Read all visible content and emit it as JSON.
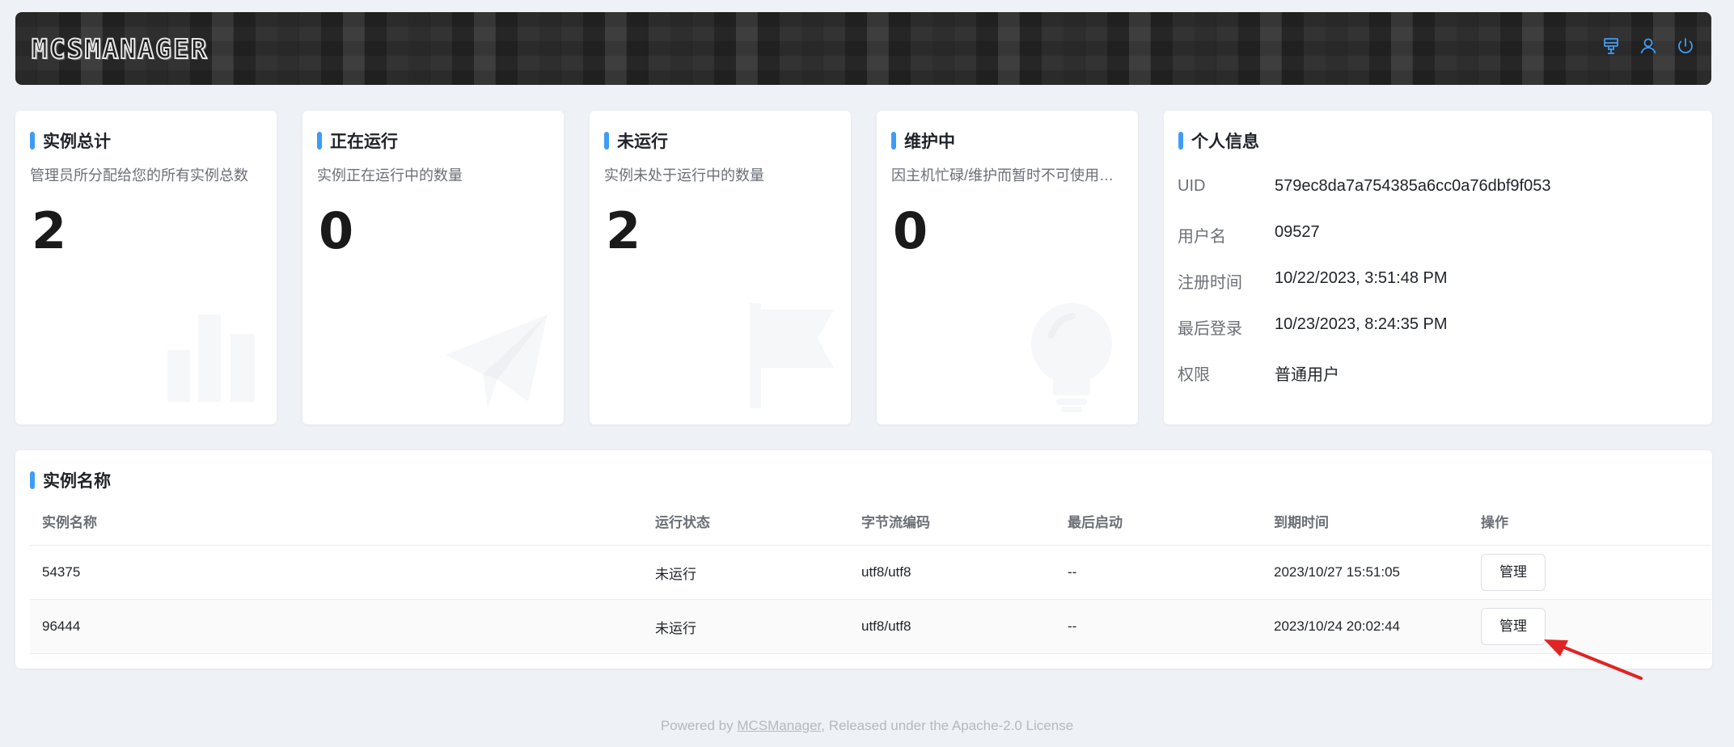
{
  "header": {
    "logo_text": "MCSMANAGER",
    "icons": [
      "plug-icon",
      "user-icon",
      "power-icon"
    ],
    "accent": "#3f9cf5"
  },
  "stats": [
    {
      "title": "实例总计",
      "desc": "管理员所分配给您的所有实例总数",
      "value": "2",
      "icon": "bar-chart-icon"
    },
    {
      "title": "正在运行",
      "desc": "实例正在运行中的数量",
      "value": "0",
      "icon": "paper-plane-icon"
    },
    {
      "title": "未运行",
      "desc": "实例未处于运行中的数量",
      "value": "2",
      "icon": "flag-icon"
    },
    {
      "title": "维护中",
      "desc": "因主机忙碌/维护而暂时不可使用…",
      "value": "0",
      "icon": "light-bulb-icon"
    }
  ],
  "profile": {
    "title": "个人信息",
    "rows": [
      {
        "label": "UID",
        "value": "579ec8da7a754385a6cc0a76dbf9f053"
      },
      {
        "label": "用户名",
        "value": "09527"
      },
      {
        "label": "注册时间",
        "value": "10/22/2023, 3:51:48 PM"
      },
      {
        "label": "最后登录",
        "value": "10/23/2023, 8:24:35 PM"
      },
      {
        "label": "权限",
        "value": "普通用户"
      }
    ]
  },
  "instances": {
    "title": "实例名称",
    "columns": [
      "实例名称",
      "运行状态",
      "字节流编码",
      "最后启动",
      "到期时间",
      "操作"
    ],
    "rows": [
      {
        "name": "54375",
        "status": "未运行",
        "encoding": "utf8/utf8",
        "last_start": "--",
        "expire": "2023/10/27 15:51:05",
        "action": "管理"
      },
      {
        "name": "96444",
        "status": "未运行",
        "encoding": "utf8/utf8",
        "last_start": "--",
        "expire": "2023/10/24 20:02:44",
        "action": "管理"
      }
    ]
  },
  "footer": {
    "prefix": "Powered by ",
    "link": "MCSManager",
    "suffix": ", Released under the Apache-2.0 License"
  },
  "annotation_color": "#e02424"
}
